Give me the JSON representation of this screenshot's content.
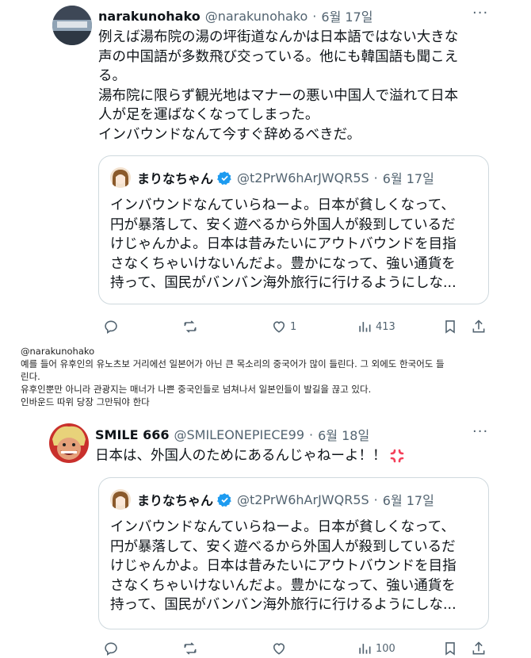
{
  "post1": {
    "name": "narakunohako",
    "handle": "@narakunohako",
    "sep": "·",
    "date": "6월 17일",
    "lines": [
      "例えば湯布院の湯の坪街道なんかは日本語ではない大きな",
      "声の中国語が多数飛び交っている。他にも韓国語も聞こえ",
      "る。",
      "湯布院に限らず観光地はマナーの悪い中国人で溢れて日本",
      "人が足を運ばなくなってしまった。",
      "インバウンドなんて今すぐ辞めるべきだ。"
    ],
    "quote": {
      "name": "まりなちゃん",
      "handle": "@t2PrW6hArJWQR5S",
      "sep": "·",
      "date": "6월 17일",
      "lines": [
        "インバウンドなんていらねーよ。日本が貧しくなって、",
        "円が暴落して、安く遊べるから外国人が殺到しているだ",
        "けじゃんかよ。日本は昔みたいにアウトバウンドを目指",
        "さなくちゃいけないんだよ。豊かになって、強い通貨を",
        "持って、国民がバンバン海外旅行に行けるようにしな..."
      ]
    },
    "actions": {
      "likes": "1",
      "views": "413"
    }
  },
  "translation": {
    "lines": [
      "@narakunohako",
      "예를 들어 유후인의 유노츠보 거리에선 일본어가 아닌 큰 목소리의 중국어가 많이 들린다. 그 외에도 한국어도 들",
      "린다.",
      "유후인뿐만 아니라 관광지는 매너가 나쁜 중국인들로 넘쳐나서 일본인들이 발길을 끊고 있다.",
      "인바운드 따위 당장 그만둬야 한다"
    ]
  },
  "post2": {
    "name": "SMILE 666",
    "handle": "@SMILEONEPIECE99",
    "sep": "·",
    "date": "6월 18일",
    "text": "日本は、外国人のためにあるんじゃねーよ！！",
    "emoji": "anger-symbol",
    "quote": {
      "name": "まりなちゃん",
      "handle": "@t2PrW6hArJWQR5S",
      "sep": "·",
      "date": "6월 17일",
      "lines": [
        "インバウンドなんていらねーよ。日本が貧しくなって、",
        "円が暴落して、安く遊べるから外国人が殺到しているだ",
        "けじゃんかよ。日本は昔みたいにアウトバウンドを目指",
        "さなくちゃいけないんだよ。豊かになって、強い通貨を",
        "持って、国民がバンバン海外旅行に行けるようにしな..."
      ]
    },
    "actions": {
      "views": "100"
    }
  },
  "colors": {
    "text": "#0f1419",
    "muted": "#536471",
    "border": "#cfd9de",
    "verified": "#1d9bf0",
    "anger": "#f4405a"
  }
}
